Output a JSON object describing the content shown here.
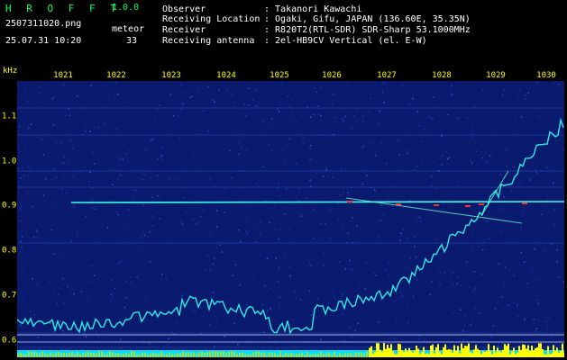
{
  "header": {
    "app_title": "H R O F F T",
    "app_version": "1.0.0",
    "file_name": "2507311020.png",
    "date_time": "25.07.31 10:20",
    "meteor_label": "meteor",
    "meteor_count": "33"
  },
  "info": [
    {
      "label": "Observer",
      "value": ": Takanori Kawachi"
    },
    {
      "label": "Receiving Location",
      "value": ": Ogaki, Gifu, JAPAN (136.60E, 35.35N)"
    },
    {
      "label": "Receiver",
      "value": ": R820T2(RTL-SDR) SDR-Sharp 53.1000MHz"
    },
    {
      "label": "Receiving antenna",
      "value": ": 2el-HB9CV Vertical (el. E-W)"
    }
  ],
  "axis": {
    "y_unit": "kHz",
    "x_ticks": [
      "1021",
      "1022",
      "1023",
      "1024",
      "1025",
      "1026",
      "1027",
      "1028",
      "1029",
      "1030"
    ],
    "y_ticks": [
      "1.1",
      "1.0",
      "0.9",
      "0.8",
      "0.7",
      "0.6"
    ]
  },
  "colors": {
    "background": "#000000",
    "waterfall_base": "#0a1a6e",
    "signal_cyan": "#33ffee",
    "signal_red": "#ff3030",
    "level_bar_yellow": "#ffff00",
    "level_bar_cyan": "#00ddff",
    "tick_text": "#ffff00",
    "title_green": "#00ff66"
  }
}
